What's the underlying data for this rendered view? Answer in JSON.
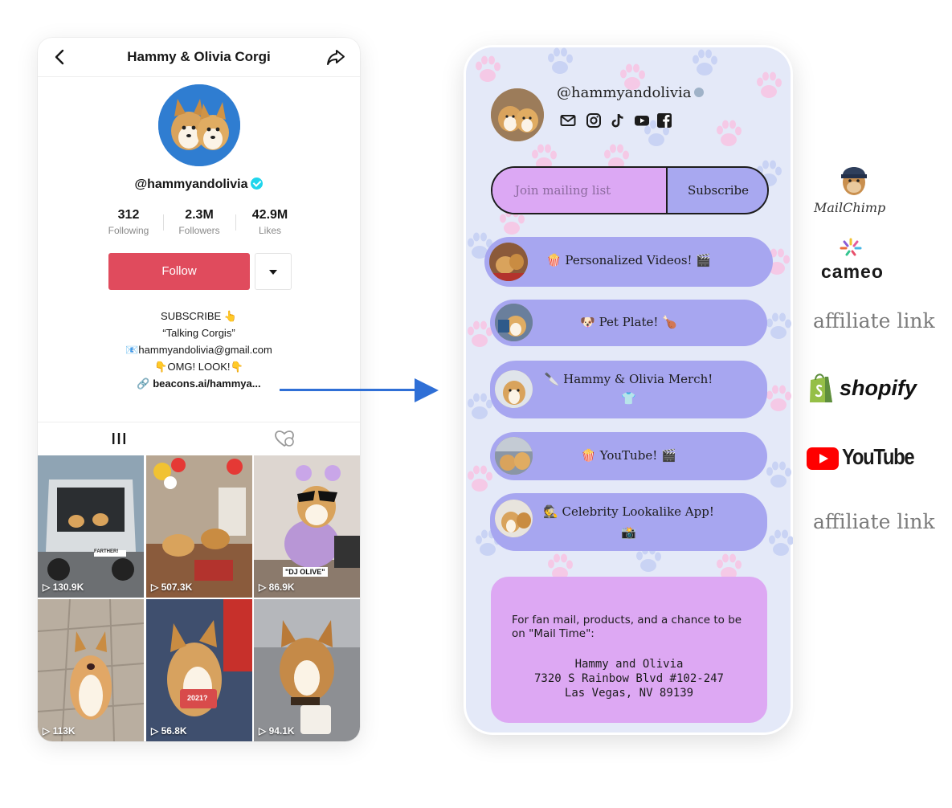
{
  "tiktok": {
    "title": "Hammy & Olivia Corgi",
    "handle": "@hammyandolivia",
    "stats": [
      {
        "value": "312",
        "label": "Following"
      },
      {
        "value": "2.3M",
        "label": "Followers"
      },
      {
        "value": "42.9M",
        "label": "Likes"
      }
    ],
    "follow_label": "Follow",
    "bio": {
      "line1": "SUBSCRIBE 👆",
      "line2": "“Talking Corgis”",
      "line3": "📧hammyandolivia@gmail.com",
      "line4": "👇OMG! LOOK!👇",
      "link": "beacons.ai/hammya..."
    },
    "videos": [
      {
        "views": "130.9K",
        "caption": "FARTHER!"
      },
      {
        "views": "507.3K",
        "caption": ""
      },
      {
        "views": "86.9K",
        "caption": "\"DJ OLIVE\""
      },
      {
        "views": "113K",
        "caption": ""
      },
      {
        "views": "56.8K",
        "caption": "2021?"
      },
      {
        "views": "94.1K",
        "caption": ""
      }
    ]
  },
  "beacons": {
    "handle": "@hammyandolivia",
    "socials": [
      "mail-icon",
      "instagram-icon",
      "tiktok-icon",
      "youtube-icon",
      "facebook-icon"
    ],
    "mailing_placeholder": "Join mailing list",
    "subscribe_label": "Subscribe",
    "links": [
      {
        "line1": "🍿 Personalized Videos! 🎬",
        "line2": ""
      },
      {
        "line1": "🐶 Pet Plate! 🍗",
        "line2": ""
      },
      {
        "line1": "🔪 Hammy & Olivia Merch!",
        "line2": "👕"
      },
      {
        "line1": "🍿 YouTube! 🎬",
        "line2": ""
      },
      {
        "line1": "🕵 Celebrity Lookalike App!",
        "line2": "📸"
      }
    ],
    "footer": {
      "text": "For fan mail, products, and a chance to be on \"Mail Time\":",
      "address1": "Hammy and Olivia",
      "address2": "7320 S Rainbow Blvd #102-247",
      "address3": "Las Vegas, NV 89139"
    }
  },
  "labels": {
    "mailchimp": "MailChimp",
    "cameo": "cameo",
    "affiliate1": "affiliate link",
    "shopify": "shopify",
    "youtube": "YouTube",
    "affiliate2": "affiliate link"
  },
  "colors": {
    "follow_button": "#e04b5d",
    "arrow": "#2f6fd6",
    "link_button": "#a7a6f0",
    "mail_input": "#dca8f4",
    "footer_card": "#dda8f3"
  }
}
